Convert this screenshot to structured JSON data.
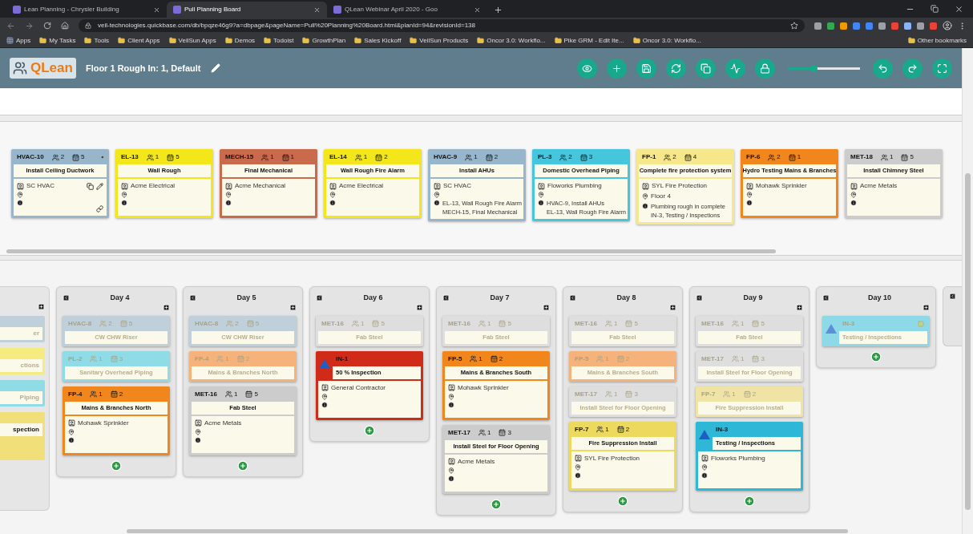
{
  "browser": {
    "tabs": [
      {
        "label": "Lean Planning - Chrysler Building",
        "selected": false
      },
      {
        "label": "Pull Planning Board",
        "selected": true
      },
      {
        "label": "QLean Webinar April 2020 - Goo",
        "selected": false
      }
    ],
    "url": "veil-technologies.quickbase.com/db/bpqze46g9?a=dbpage&pageName=Pull%20Planning%20Board.html&planId=94&revisionId=138",
    "bookmarks": [
      "Apps",
      "My Tasks",
      "Tools",
      "Client Apps",
      "VeilSun Apps",
      "Demos",
      "Todoist",
      "GrowthPlan",
      "Sales Kickoff",
      "VeilSun Products",
      "Oncor 3.0: Workflo...",
      "Pike GRM - Edit Ite...",
      "Oncor 3.0: Workflo..."
    ],
    "other_bookmarks": "Other bookmarks"
  },
  "app": {
    "logo": "QLean",
    "title": "Floor 1 Rough In: 1, Default",
    "zoom": {
      "level": 0.35
    }
  },
  "unscheduled": [
    {
      "id": "HVAC-10",
      "people": "2",
      "days": "5",
      "title": "Install Ceiling Ductwork",
      "company": "SC HVAC",
      "color": "#98b6cb",
      "hovered": true
    },
    {
      "id": "EL-13",
      "people": "1",
      "days": "5",
      "title": "Wall Rough",
      "company": "Acme Electrical",
      "color": "#f3e61a",
      "hovered": false
    },
    {
      "id": "MECH-15",
      "people": "1",
      "days": "1",
      "title": "Final Mechanical",
      "company": "Acme Mechanical",
      "color": "#c96a4c",
      "hovered": false
    },
    {
      "id": "EL-14",
      "people": "1",
      "days": "2",
      "title": "Wall Rough Fire Alarm",
      "company": "Acme Electrical",
      "color": "#f3e61a",
      "hovered": false
    },
    {
      "id": "HVAC-9",
      "people": "1",
      "days": "2",
      "title": "Install AHUs",
      "company": "SC HVAC",
      "info": [
        "EL-13, Wall Rough Fire Alarm",
        "MECH-15, Final Mechanical"
      ],
      "color": "#98b6cb",
      "hovered": false
    },
    {
      "id": "PL-3",
      "people": "2",
      "days": "3",
      "title": "Domestic Overhead Piping",
      "company": "Floworks Plumbing",
      "info": [
        "HVAC-9, Install AHUs",
        "EL-13, Wall Rough Fire Alarm"
      ],
      "color": "#45c6dc",
      "hovered": false
    },
    {
      "id": "FP-1",
      "people": "2",
      "days": "4",
      "title": "Complete fire protection system",
      "company": "SYL Fire Protection",
      "location": "Floor 4",
      "info": [
        "Plumbing rough in complete",
        "IN-3, Testing / Inspections"
      ],
      "color": "#f6e78a",
      "hovered": false
    },
    {
      "id": "FP-6",
      "people": "2",
      "days": "1",
      "title": "Hydro Testing Mains & Branches",
      "company": "Mohawk Sprinkler",
      "color": "#f0861c",
      "hovered": false
    },
    {
      "id": "MET-18",
      "people": "1",
      "days": "5",
      "title": "Install Chimney Steel",
      "company": "Acme Metals",
      "color": "#cccccc",
      "hovered": false
    }
  ],
  "columns": [
    {
      "kind": "partial-left",
      "cards": [
        {
          "title": "er",
          "color": "#bfd0db",
          "faded": true
        },
        {
          "title": "ctions",
          "color": "#f5ec80",
          "faded": true
        },
        {
          "title": "Piping",
          "color": "#8fdbe6",
          "faded": true
        },
        {
          "title": "spection",
          "color": "#f1e07a",
          "faded": false
        }
      ]
    },
    {
      "kind": "day",
      "title": "Day 4",
      "cards": [
        {
          "kind": "task",
          "id": "HVAC-8",
          "people": "2",
          "days": "5",
          "title": "CW CHW Riser",
          "color": "#bfd0db",
          "faded": true
        },
        {
          "kind": "task",
          "id": "PL-2",
          "people": "1",
          "days": "3",
          "title": "Sanitary Overhead Piping",
          "color": "#8fdbe6",
          "faded": true
        },
        {
          "kind": "task",
          "id": "FP-4",
          "people": "1",
          "days": "2",
          "title": "Mains & Branches North",
          "company": "Mohawk Sprinkler",
          "color": "#f0861c",
          "faded": false
        }
      ]
    },
    {
      "kind": "day",
      "title": "Day 5",
      "cards": [
        {
          "kind": "task",
          "id": "HVAC-8",
          "people": "2",
          "days": "5",
          "title": "CW CHW Riser",
          "color": "#bfd0db",
          "faded": true
        },
        {
          "kind": "task",
          "id": "FP-4",
          "people": "1",
          "days": "2",
          "title": "Mains & Branches North",
          "color": "#f5b27a",
          "faded": true
        },
        {
          "kind": "task",
          "id": "MET-16",
          "people": "1",
          "days": "5",
          "title": "Fab Steel",
          "company": "Acme Metals",
          "color": "#cccccc",
          "faded": false
        }
      ]
    },
    {
      "kind": "day",
      "title": "Day 6",
      "cards": [
        {
          "kind": "task",
          "id": "MET-16",
          "people": "1",
          "days": "5",
          "title": "Fab Steel",
          "color": "#dedede",
          "faded": true
        },
        {
          "kind": "milestone",
          "id": "IN-1",
          "title": "50 % Inspection",
          "company": "General Contractor",
          "color": "#cf2b18",
          "faded": false
        }
      ]
    },
    {
      "kind": "day",
      "title": "Day 7",
      "cards": [
        {
          "kind": "task",
          "id": "MET-16",
          "people": "1",
          "days": "5",
          "title": "Fab Steel",
          "color": "#dedede",
          "faded": true
        },
        {
          "kind": "task",
          "id": "FP-5",
          "people": "1",
          "days": "2",
          "title": "Mains & Branches South",
          "company": "Mohawk Sprinkler",
          "color": "#f0861c",
          "faded": false
        },
        {
          "kind": "task",
          "id": "MET-17",
          "people": "1",
          "days": "3",
          "title": "Install Steel for Floor Opening",
          "company": "Acme Metals",
          "color": "#cccccc",
          "faded": false
        }
      ]
    },
    {
      "kind": "day",
      "title": "Day 8",
      "cards": [
        {
          "kind": "task",
          "id": "MET-16",
          "people": "1",
          "days": "5",
          "title": "Fab Steel",
          "color": "#dedede",
          "faded": true
        },
        {
          "kind": "task",
          "id": "FP-5",
          "people": "1",
          "days": "2",
          "title": "Mains & Branches South",
          "color": "#f5b27a",
          "faded": true
        },
        {
          "kind": "task",
          "id": "MET-17",
          "people": "1",
          "days": "3",
          "title": "Install Steel for Floor Opening",
          "color": "#dedede",
          "faded": true
        },
        {
          "kind": "task",
          "id": "FP-7",
          "people": "1",
          "days": "2",
          "title": "Fire Suppression Install",
          "company": "SYL Fire Protection",
          "color": "#ecd95e",
          "faded": false
        }
      ]
    },
    {
      "kind": "day",
      "title": "Day 9",
      "cards": [
        {
          "kind": "task",
          "id": "MET-16",
          "people": "1",
          "days": "5",
          "title": "Fab Steel",
          "color": "#dedede",
          "faded": true
        },
        {
          "kind": "task",
          "id": "MET-17",
          "people": "1",
          "days": "3",
          "title": "Install Steel for Floor Opening",
          "color": "#dedede",
          "faded": true
        },
        {
          "kind": "task",
          "id": "FP-7",
          "people": "1",
          "days": "2",
          "title": "Fire Suppression Install",
          "color": "#efe3a6",
          "faded": true
        },
        {
          "kind": "milestone",
          "id": "IN-3",
          "title": "Testing / Inspections",
          "company": "Floworks Plumbing",
          "color": "#2fb7d8",
          "faded": false
        }
      ]
    },
    {
      "kind": "day",
      "title": "Day 10",
      "cards": [
        {
          "kind": "milestone",
          "id": "IN-3",
          "title": "Testing / Inspections",
          "color": "#8ed9e8",
          "faded": true
        }
      ]
    },
    {
      "kind": "partial-right"
    }
  ]
}
